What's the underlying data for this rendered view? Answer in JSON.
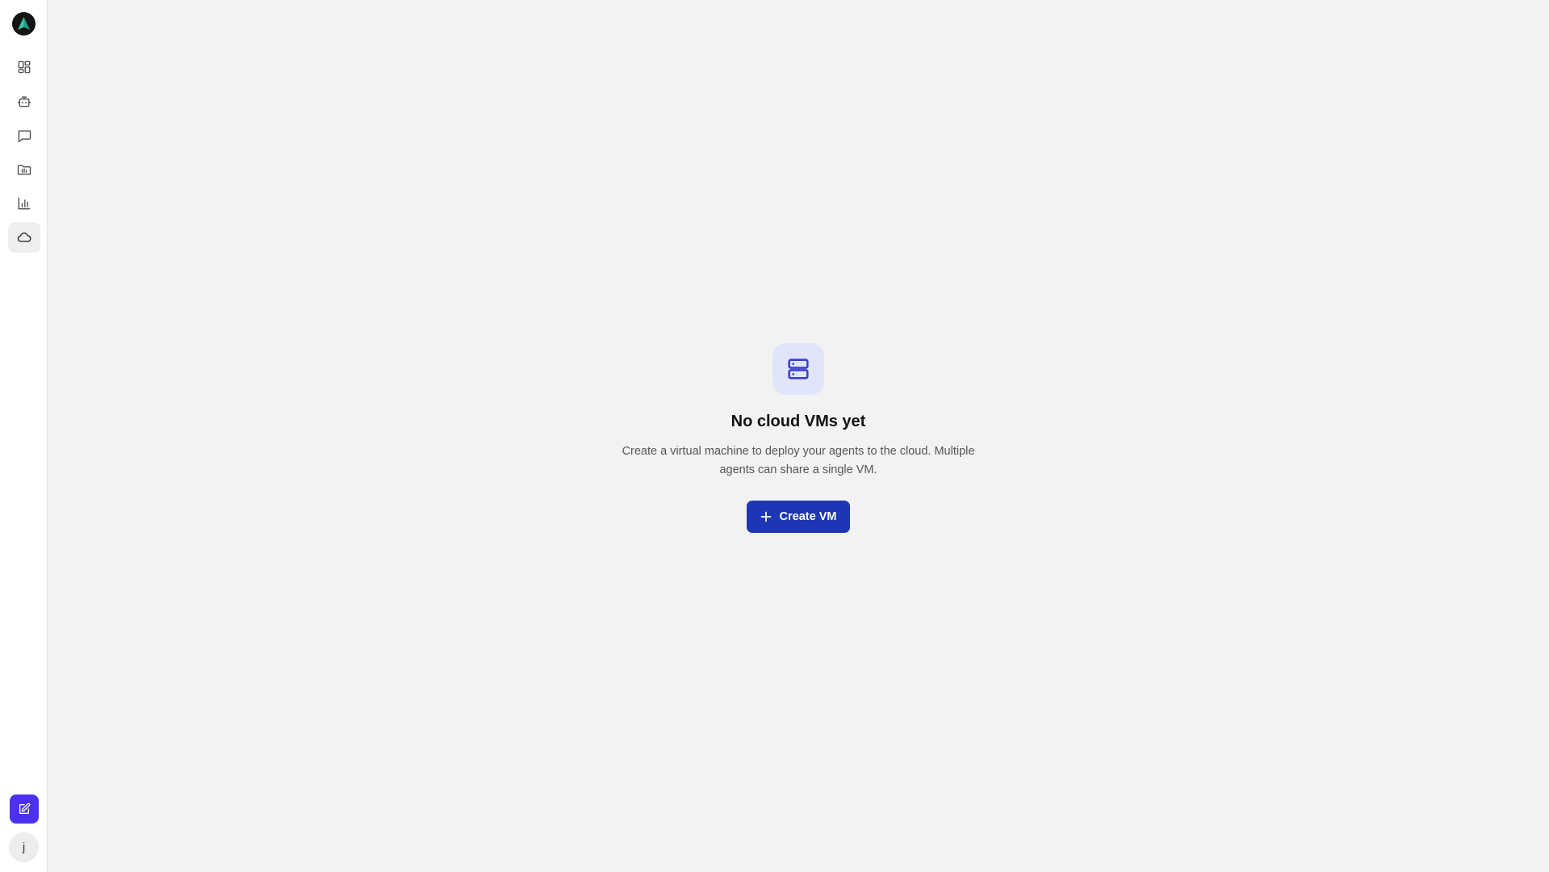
{
  "sidebar": {
    "logo_icon": "triangle-logo-icon",
    "items": [
      {
        "name": "dashboard",
        "icon": "grid-icon",
        "active": false
      },
      {
        "name": "agents",
        "icon": "bot-icon",
        "active": false
      },
      {
        "name": "chat",
        "icon": "chat-bubble-icon",
        "active": false
      },
      {
        "name": "files",
        "icon": "folder-icon",
        "active": false
      },
      {
        "name": "analytics",
        "icon": "bar-chart-icon",
        "active": false
      },
      {
        "name": "cloud",
        "icon": "cloud-icon",
        "active": true
      }
    ],
    "compose_icon": "edit-icon",
    "avatar_initial": "j"
  },
  "main": {
    "empty_state": {
      "icon": "server-icon",
      "title": "No cloud VMs yet",
      "description": "Create a virtual machine to deploy your agents to the cloud. Multiple agents can share a single VM.",
      "button_label": "Create VM",
      "button_icon": "plus-icon"
    }
  },
  "colors": {
    "accent_button": "#1d36b3",
    "compose_button": "#4b32f0",
    "icon_tile_bg": "#e0e5fb",
    "icon_tile_fg": "#3a3ed0",
    "page_bg": "#f2f2f2"
  }
}
